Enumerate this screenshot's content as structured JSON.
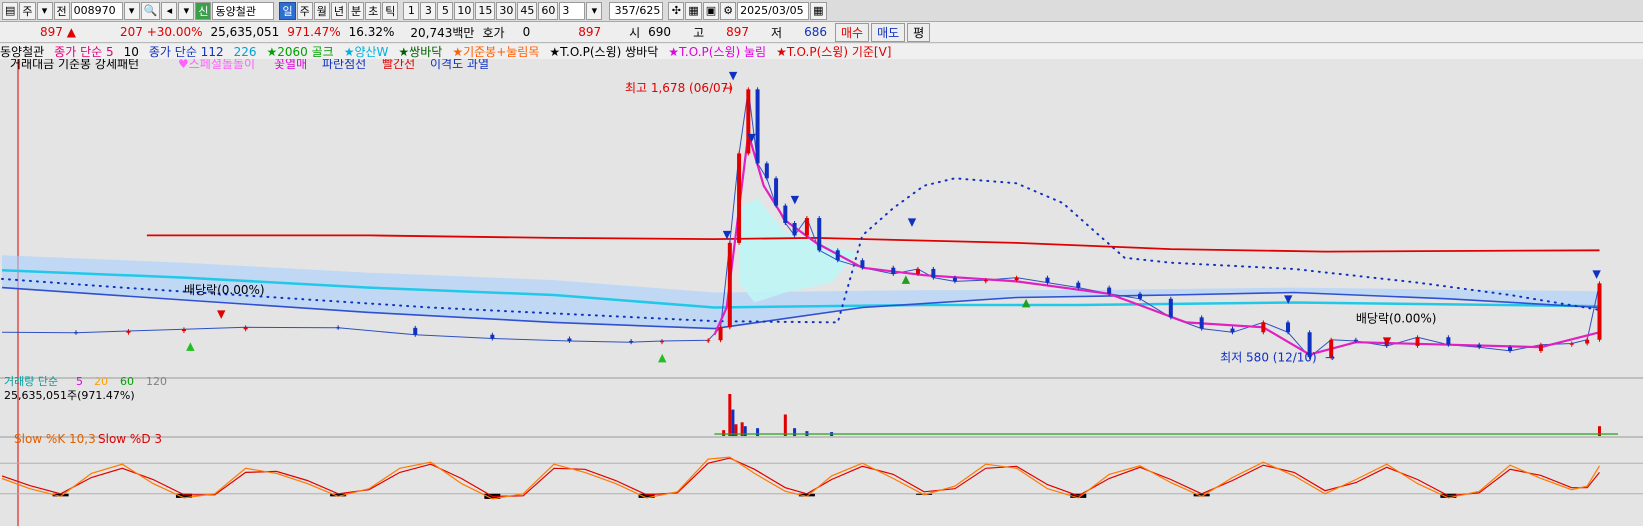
{
  "toolbar": {
    "period": "주",
    "view_mode": "전",
    "stock_code": "008970",
    "stock_name": "동양철관",
    "stock_badge": "신",
    "periods": [
      "일",
      "주",
      "월",
      "년",
      "분",
      "초",
      "틱"
    ],
    "active_period": "일",
    "intervals": [
      "1",
      "3",
      "5",
      "10",
      "15",
      "30",
      "45",
      "60"
    ],
    "count_value": "3",
    "page_current": "357",
    "page_total": "/625",
    "date": "2025/03/05",
    "even_label": "평"
  },
  "quote": {
    "price": "897",
    "change": "207",
    "change_pct": "+30.00%",
    "volume": "25,635,051",
    "volume_ratio": "971.47%",
    "turnover": "16.32%",
    "amount": "20,743백만",
    "hoga_label": "호가",
    "hoga_value": "0",
    "hoga_price": "897",
    "open_label": "시",
    "open": "690",
    "high_label": "고",
    "high": "897",
    "low_label": "저",
    "low": "686",
    "buy_label": "매수",
    "sell_label": "매도"
  },
  "indicators_row1": [
    {
      "text": "동양철관",
      "color": "#000000"
    },
    {
      "text": "종가 단순 5",
      "color": "#e0007a"
    },
    {
      "text": "10",
      "color": "#000000"
    },
    {
      "text": "종가 단순 112",
      "color": "#1030c0"
    },
    {
      "text": "226",
      "color": "#00a0d0"
    },
    {
      "text": "★2060 골크",
      "color": "#00a000"
    },
    {
      "text": "★양산W",
      "color": "#00b0e0"
    },
    {
      "text": "★쌍바닥",
      "color": "#006000"
    },
    {
      "text": "★기준봉+눌림목",
      "color": "#ff6000"
    },
    {
      "text": "★T.O.P(스윙) 쌍바닥",
      "color": "#000000"
    },
    {
      "text": "★T.O.P(스윙) 눌림",
      "color": "#e000e0"
    },
    {
      "text": "★T.O.P(스윙) 기준[V]",
      "color": "#e00000"
    }
  ],
  "indicators_row2": [
    {
      "text": "거래대금 기준봉 강세패턴",
      "color": "#000000"
    },
    {
      "text": "♥스페셜돌돌이",
      "color": "#ff60ff"
    },
    {
      "text": "꽃열매",
      "color": "#e000e0"
    },
    {
      "text": "파란점선",
      "color": "#1030c0"
    },
    {
      "text": "빨간선",
      "color": "#e00000"
    },
    {
      "text": "이격도 과열",
      "color": "#1030c0"
    }
  ],
  "chart_data": {
    "type": "line",
    "symbol": "동양철관",
    "x_domain": [
      1,
      525
    ],
    "y_domain": [
      520,
      1760
    ],
    "annotations": {
      "high": "최고 1,678 (06/07)",
      "low": "최저 580 (12/10)",
      "dividend_1": "배당락(0.00%)",
      "dividend_2": "배당락(0.00%)"
    },
    "price_panel": {
      "series_close": [
        [
          1,
          700
        ],
        [
          25,
          698
        ],
        [
          42,
          705
        ],
        [
          60,
          712
        ],
        [
          80,
          720
        ],
        [
          110,
          718
        ],
        [
          135,
          690
        ],
        [
          160,
          675
        ],
        [
          185,
          665
        ],
        [
          205,
          660
        ],
        [
          215,
          665
        ],
        [
          230,
          668
        ],
        [
          234,
          720
        ],
        [
          237,
          1060
        ],
        [
          240,
          1420
        ],
        [
          243,
          1678
        ],
        [
          246,
          1380
        ],
        [
          249,
          1320
        ],
        [
          252,
          1210
        ],
        [
          255,
          1140
        ],
        [
          258,
          1090
        ],
        [
          262,
          1160
        ],
        [
          266,
          1030
        ],
        [
          272,
          990
        ],
        [
          280,
          960
        ],
        [
          290,
          935
        ],
        [
          298,
          955
        ],
        [
          303,
          920
        ],
        [
          310,
          905
        ],
        [
          320,
          910
        ],
        [
          330,
          920
        ],
        [
          340,
          900
        ],
        [
          350,
          880
        ],
        [
          360,
          855
        ],
        [
          370,
          835
        ],
        [
          380,
          760
        ],
        [
          390,
          715
        ],
        [
          400,
          700
        ],
        [
          410,
          740
        ],
        [
          418,
          700
        ],
        [
          425,
          600
        ],
        [
          432,
          670
        ],
        [
          440,
          665
        ],
        [
          450,
          645
        ],
        [
          460,
          680
        ],
        [
          470,
          650
        ],
        [
          480,
          640
        ],
        [
          490,
          625
        ],
        [
          500,
          650
        ],
        [
          510,
          655
        ],
        [
          515,
          670
        ],
        [
          519,
          897
        ]
      ],
      "ma5": [
        [
          232,
          690
        ],
        [
          236,
          800
        ],
        [
          240,
          1200
        ],
        [
          243,
          1500
        ],
        [
          248,
          1290
        ],
        [
          255,
          1150
        ],
        [
          265,
          1060
        ],
        [
          280,
          960
        ],
        [
          300,
          930
        ],
        [
          330,
          905
        ],
        [
          360,
          855
        ],
        [
          385,
          740
        ],
        [
          410,
          720
        ],
        [
          425,
          610
        ],
        [
          440,
          660
        ],
        [
          470,
          650
        ],
        [
          500,
          640
        ],
        [
          519,
          700
        ]
      ],
      "ma112_dark_blue": [
        [
          1,
          880
        ],
        [
          60,
          830
        ],
        [
          120,
          780
        ],
        [
          180,
          740
        ],
        [
          232,
          715
        ],
        [
          280,
          800
        ],
        [
          330,
          840
        ],
        [
          380,
          850
        ],
        [
          420,
          860
        ],
        [
          470,
          835
        ],
        [
          519,
          800
        ]
      ],
      "ma226_cyan": [
        [
          1,
          950
        ],
        [
          60,
          920
        ],
        [
          120,
          880
        ],
        [
          180,
          850
        ],
        [
          232,
          800
        ],
        [
          300,
          810
        ],
        [
          350,
          810
        ],
        [
          420,
          820
        ],
        [
          519,
          805
        ]
      ],
      "red_line": [
        [
          48,
          1090
        ],
        [
          120,
          1090
        ],
        [
          180,
          1080
        ],
        [
          232,
          1075
        ],
        [
          265,
          1080
        ],
        [
          330,
          1060
        ],
        [
          380,
          1035
        ],
        [
          430,
          1025
        ],
        [
          519,
          1030
        ]
      ],
      "dotted_envelope": [
        [
          1,
          915
        ],
        [
          40,
          880
        ],
        [
          90,
          840
        ],
        [
          140,
          800
        ],
        [
          190,
          770
        ],
        [
          232,
          745
        ],
        [
          272,
          740
        ],
        [
          280,
          1090
        ],
        [
          290,
          1200
        ],
        [
          300,
          1290
        ],
        [
          310,
          1320
        ],
        [
          330,
          1300
        ],
        [
          345,
          1220
        ],
        [
          355,
          1110
        ],
        [
          365,
          1000
        ],
        [
          380,
          980
        ],
        [
          420,
          955
        ],
        [
          460,
          900
        ],
        [
          490,
          850
        ],
        [
          519,
          790
        ]
      ]
    },
    "volume_panel": {
      "label": "거래량 단순",
      "ma_periods": [
        {
          "label": "5",
          "color": "#e000e0"
        },
        {
          "label": "20",
          "color": "#ffa000"
        },
        {
          "label": "60",
          "color": "#00a000"
        },
        {
          "label": "120",
          "color": "#808080"
        }
      ],
      "current": "25,635,051주(971.47%)",
      "spikes": [
        [
          235,
          6
        ],
        [
          237,
          43
        ],
        [
          238,
          27
        ],
        [
          239,
          12
        ],
        [
          241,
          14
        ],
        [
          242,
          10
        ],
        [
          246,
          8
        ],
        [
          255,
          22
        ],
        [
          258,
          8
        ],
        [
          262,
          5
        ],
        [
          270,
          4
        ],
        [
          519,
          10
        ]
      ]
    },
    "stochastic_panel": {
      "label_k": "Slow %K 10,3",
      "label_d": "Slow %D 3",
      "k": [
        [
          1,
          50
        ],
        [
          10,
          30
        ],
        [
          20,
          15
        ],
        [
          30,
          60
        ],
        [
          40,
          78
        ],
        [
          50,
          40
        ],
        [
          60,
          12
        ],
        [
          70,
          20
        ],
        [
          80,
          70
        ],
        [
          90,
          60
        ],
        [
          100,
          40
        ],
        [
          110,
          15
        ],
        [
          120,
          30
        ],
        [
          130,
          70
        ],
        [
          140,
          82
        ],
        [
          150,
          40
        ],
        [
          160,
          10
        ],
        [
          170,
          20
        ],
        [
          180,
          78
        ],
        [
          190,
          62
        ],
        [
          200,
          40
        ],
        [
          210,
          12
        ],
        [
          220,
          24
        ],
        [
          230,
          88
        ],
        [
          237,
          92
        ],
        [
          245,
          60
        ],
        [
          255,
          25
        ],
        [
          262,
          15
        ],
        [
          270,
          55
        ],
        [
          280,
          80
        ],
        [
          290,
          50
        ],
        [
          300,
          18
        ],
        [
          310,
          35
        ],
        [
          320,
          78
        ],
        [
          330,
          70
        ],
        [
          340,
          30
        ],
        [
          350,
          12
        ],
        [
          360,
          58
        ],
        [
          370,
          75
        ],
        [
          380,
          42
        ],
        [
          390,
          15
        ],
        [
          400,
          52
        ],
        [
          410,
          82
        ],
        [
          420,
          55
        ],
        [
          430,
          20
        ],
        [
          440,
          48
        ],
        [
          450,
          78
        ],
        [
          460,
          40
        ],
        [
          470,
          12
        ],
        [
          480,
          25
        ],
        [
          490,
          76
        ],
        [
          500,
          50
        ],
        [
          510,
          28
        ],
        [
          515,
          35
        ],
        [
          519,
          75
        ]
      ],
      "d": [
        [
          1,
          55
        ],
        [
          10,
          36
        ],
        [
          20,
          20
        ],
        [
          30,
          52
        ],
        [
          40,
          70
        ],
        [
          50,
          48
        ],
        [
          60,
          18
        ],
        [
          70,
          18
        ],
        [
          80,
          62
        ],
        [
          90,
          64
        ],
        [
          100,
          46
        ],
        [
          110,
          20
        ],
        [
          120,
          28
        ],
        [
          130,
          62
        ],
        [
          140,
          78
        ],
        [
          150,
          50
        ],
        [
          160,
          15
        ],
        [
          170,
          16
        ],
        [
          180,
          70
        ],
        [
          190,
          68
        ],
        [
          200,
          46
        ],
        [
          210,
          18
        ],
        [
          220,
          22
        ],
        [
          230,
          80
        ],
        [
          237,
          90
        ],
        [
          245,
          68
        ],
        [
          255,
          32
        ],
        [
          262,
          20
        ],
        [
          270,
          48
        ],
        [
          280,
          74
        ],
        [
          290,
          58
        ],
        [
          300,
          24
        ],
        [
          310,
          30
        ],
        [
          320,
          70
        ],
        [
          330,
          74
        ],
        [
          340,
          38
        ],
        [
          350,
          16
        ],
        [
          360,
          50
        ],
        [
          370,
          72
        ],
        [
          380,
          48
        ],
        [
          390,
          20
        ],
        [
          400,
          46
        ],
        [
          410,
          76
        ],
        [
          420,
          62
        ],
        [
          430,
          26
        ],
        [
          440,
          42
        ],
        [
          450,
          72
        ],
        [
          460,
          48
        ],
        [
          470,
          16
        ],
        [
          480,
          22
        ],
        [
          490,
          68
        ],
        [
          500,
          56
        ],
        [
          510,
          32
        ],
        [
          515,
          32
        ],
        [
          519,
          62
        ]
      ]
    }
  }
}
